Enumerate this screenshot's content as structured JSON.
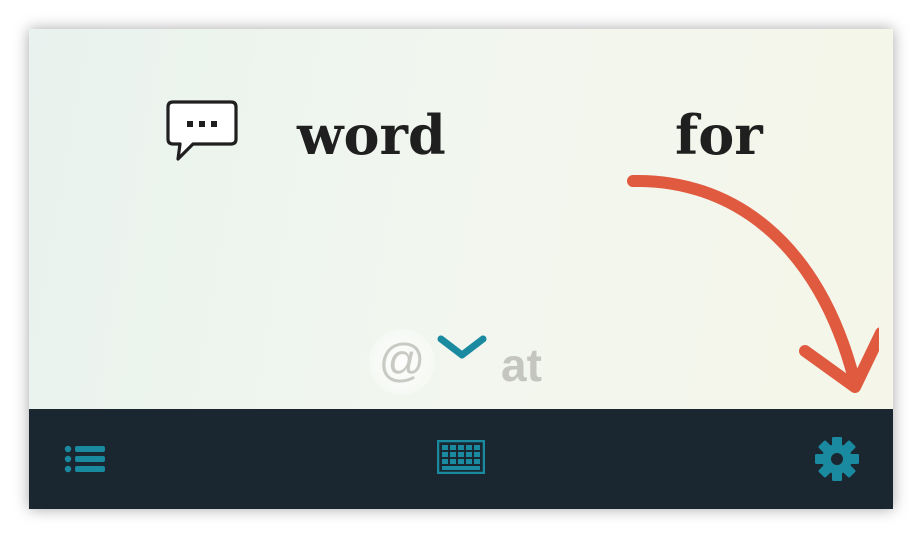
{
  "words": {
    "first": "word",
    "second": "for"
  },
  "suggestions": {
    "symbol": "@",
    "next_word": "at"
  },
  "colors": {
    "accent_teal": "#1a8aa0",
    "toolbar_bg": "#1b2730",
    "arrow_orange": "#e05a3f",
    "word_text": "#1f1f1f"
  },
  "icons": {
    "chat": "speech-bubble-icon",
    "chevron": "chevron-down-icon",
    "list": "list-icon",
    "keyboard": "keyboard-icon",
    "settings": "gear-icon",
    "annotation": "curved-arrow-icon"
  }
}
